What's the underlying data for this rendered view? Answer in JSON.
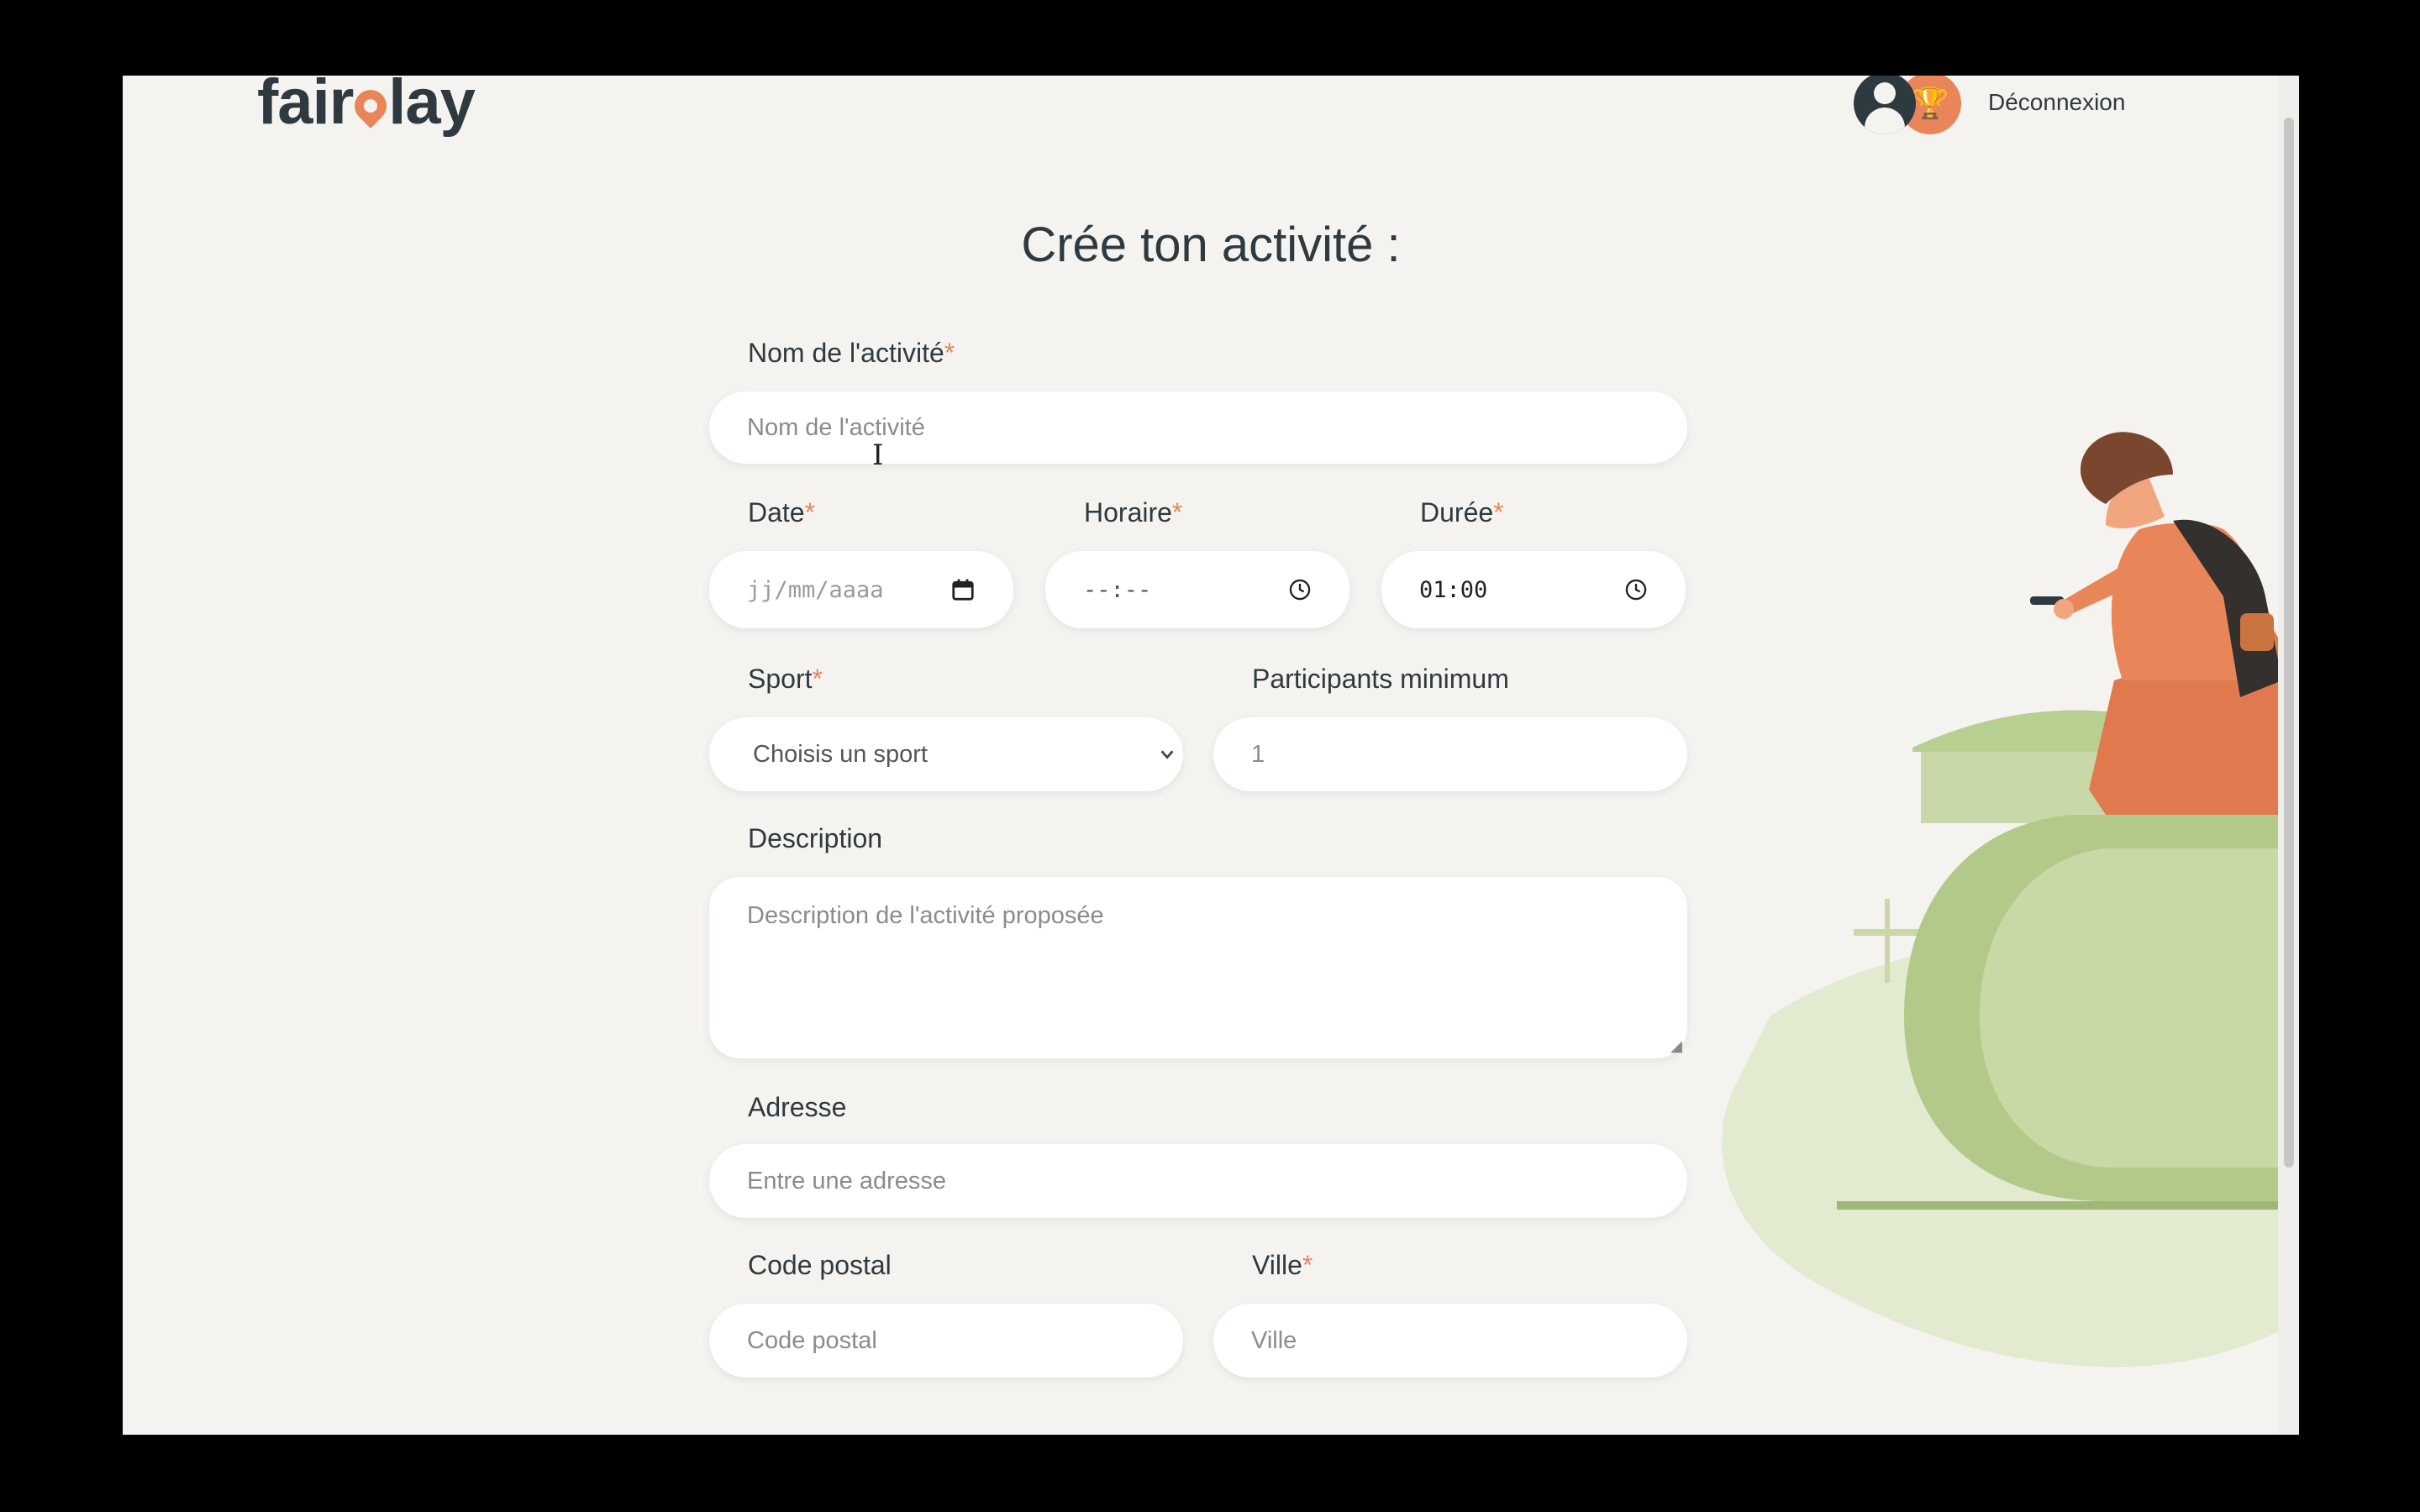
{
  "header": {
    "logo_text_1": "fair",
    "logo_text_2": "lay",
    "logout_label": "Déconnexion"
  },
  "form": {
    "title": "Crée ton activité :",
    "required_mark": "*",
    "name": {
      "label": "Nom de l'activité",
      "placeholder": "Nom de l'activité"
    },
    "date": {
      "label": "Date",
      "value": "jj/mm/aaaa"
    },
    "time": {
      "label": "Horaire",
      "value": "--:--"
    },
    "duration": {
      "label": "Durée",
      "value": "01:00"
    },
    "sport": {
      "label": "Sport",
      "selected": "Choisis un sport"
    },
    "participants": {
      "label": "Participants minimum",
      "value": "1"
    },
    "description": {
      "label": "Description",
      "placeholder": "Description de l'activité proposée"
    },
    "address": {
      "label": "Adresse",
      "placeholder": "Entre une adresse"
    },
    "postal_code": {
      "label": "Code postal",
      "placeholder": "Code postal"
    },
    "city": {
      "label": "Ville",
      "placeholder": "Ville"
    }
  },
  "colors": {
    "accent": "#e8865a",
    "text": "#2e3a40",
    "background": "#f5f3ef",
    "illustration_green": "#a8c17f"
  },
  "icons": [
    "user-icon",
    "trophy-icon",
    "calendar-icon",
    "clock-icon",
    "chevron-down-icon"
  ]
}
